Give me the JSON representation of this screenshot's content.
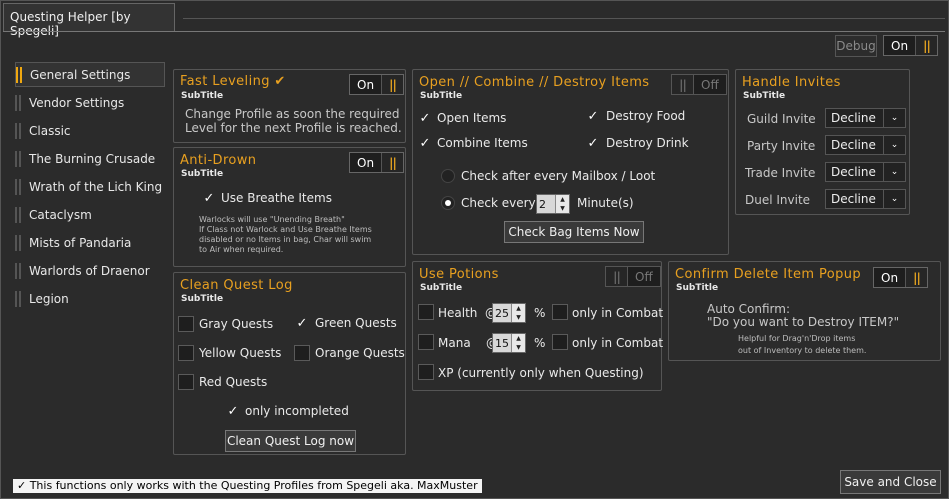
{
  "window": {
    "title": "Questing Helper [by Spegeli]"
  },
  "topbar": {
    "debug_label": "Debug",
    "main_toggle": {
      "label": "On",
      "state": "on"
    }
  },
  "nav": {
    "items": [
      {
        "label": "General Settings",
        "selected": true
      },
      {
        "label": "Vendor Settings"
      },
      {
        "label": "Classic"
      },
      {
        "label": "The Burning Crusade"
      },
      {
        "label": "Wrath of the Lich King"
      },
      {
        "label": "Cataclysm"
      },
      {
        "label": "Mists of Pandaria"
      },
      {
        "label": "Warlords of Draenor"
      },
      {
        "label": "Legion"
      }
    ]
  },
  "fast_leveling": {
    "title": "Fast  Leveling",
    "title_mark": "✔",
    "subtitle": "SubTitle",
    "toggle_label": "On",
    "desc_line1": "Change Profile as soon the required",
    "desc_line2": "Level for the next Profile is reached."
  },
  "anti_drown": {
    "title": "Anti-Drown",
    "subtitle": "SubTitle",
    "toggle_label": "On",
    "use_breathe": {
      "label": "Use Breathe Items",
      "checked": true
    },
    "note_line1": "Warlocks will use \"Unending Breath\"",
    "note_line2": "If Class not Warlock and Use Breathe Items",
    "note_line3": "disabled or no Items in bag, Char will swim",
    "note_line4": "to Air when required."
  },
  "clean_quest_log": {
    "title": "Clean Quest Log",
    "subtitle": "SubTitle",
    "gray": {
      "label": "Gray Quests",
      "checked": false
    },
    "green": {
      "label": "Green Quests",
      "checked": true
    },
    "yellow": {
      "label": "Yellow Quests",
      "checked": false
    },
    "orange": {
      "label": "Orange Quests",
      "checked": false
    },
    "red": {
      "label": "Red Quests",
      "checked": false
    },
    "only_incompleted": {
      "label": "only incompleted",
      "checked": true
    },
    "button": "Clean Quest Log now"
  },
  "items": {
    "title": "Open // Combine // Destroy Items",
    "subtitle": "SubTitle",
    "toggle_label": "Off",
    "open_items": {
      "label": "Open Items",
      "checked": true
    },
    "combine_items": {
      "label": "Combine Items",
      "checked": true
    },
    "destroy_food": {
      "label": "Destroy Food",
      "checked": true
    },
    "destroy_drink": {
      "label": "Destroy Drink",
      "checked": true
    },
    "radio_mailbox": {
      "label": "Check after every Mailbox / Loot",
      "selected": false
    },
    "radio_every": {
      "label": "Check every",
      "selected": true
    },
    "minutes_value": "2",
    "minutes_label": "Minute(s)",
    "button": "Check Bag Items Now"
  },
  "invites": {
    "title": "Handle Invites",
    "subtitle": "SubTitle",
    "rows": [
      {
        "label": "Guild Invite",
        "value": "Decline"
      },
      {
        "label": "Party Invite",
        "value": "Decline"
      },
      {
        "label": "Trade Invite",
        "value": "Decline"
      },
      {
        "label": "Duel Invite",
        "value": "Decline"
      }
    ]
  },
  "potions": {
    "title": "Use Potions",
    "subtitle": "SubTitle",
    "toggle_label": "Off",
    "health": {
      "label": "Health",
      "at": "@",
      "value": "25",
      "unit": "%",
      "combat_label": "only in Combat"
    },
    "mana": {
      "label": "Mana",
      "at": "@",
      "value": "15",
      "unit": "%",
      "combat_label": "only in Combat"
    },
    "xp": {
      "label": "XP (currently only when Questing)"
    }
  },
  "confirm_delete": {
    "title": "Confirm Delete Item Popup",
    "subtitle": "SubTitle",
    "toggle_label": "On",
    "auto_line1": "Auto Confirm:",
    "auto_line2": "\"Do you want to Destroy ITEM?\"",
    "help_line1": "Helpful for Drag'n'Drop items",
    "help_line2": "out of Inventory to delete them."
  },
  "footer": {
    "note": "✓ This functions only works with the Questing Profiles from Spegeli aka. MaxMuster",
    "save_close": "Save and Close"
  },
  "icons": {
    "toggle_knob": "pause-bars",
    "dropdown": "chevron-down",
    "check": "checkmark"
  },
  "colors": {
    "accent": "#e8a020",
    "background": "#2b2b2b",
    "panel_border": "#555555"
  }
}
